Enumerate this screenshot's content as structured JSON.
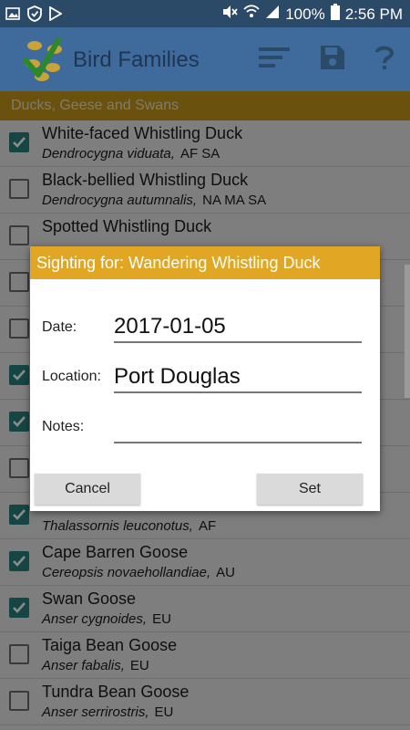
{
  "status_bar": {
    "battery": "100%",
    "time": "2:56 PM"
  },
  "app_bar": {
    "title": "Bird Families"
  },
  "section": {
    "title": "Ducks, Geese and Swans"
  },
  "birds": [
    {
      "name": "White-faced Whistling Duck",
      "scientific": "Dendrocygna viduata,",
      "regions": "AF  SA",
      "checked": true
    },
    {
      "name": "Black-bellied Whistling Duck",
      "scientific": "Dendrocygna autumnalis,",
      "regions": "NA  MA  SA",
      "checked": false
    },
    {
      "name": "Spotted Whistling Duck",
      "scientific": "",
      "regions": "",
      "checked": false
    },
    {
      "name": "",
      "scientific": "",
      "regions": "",
      "checked": false
    },
    {
      "name": "",
      "scientific": "",
      "regions": "",
      "checked": false
    },
    {
      "name": "",
      "scientific": "",
      "regions": "",
      "checked": true
    },
    {
      "name": "",
      "scientific": "",
      "regions": "",
      "checked": true
    },
    {
      "name": "",
      "scientific": "",
      "regions": "",
      "checked": false
    },
    {
      "name": "",
      "scientific": "Thalassornis leuconotus,",
      "regions": "AF",
      "checked": true
    },
    {
      "name": "Cape Barren Goose",
      "scientific": "Cereopsis novaehollandiae,",
      "regions": "AU",
      "checked": true
    },
    {
      "name": "Swan Goose",
      "scientific": "Anser cygnoides,",
      "regions": "EU",
      "checked": true
    },
    {
      "name": "Taiga Bean Goose",
      "scientific": "Anser fabalis,",
      "regions": "EU",
      "checked": false
    },
    {
      "name": "Tundra Bean Goose",
      "scientific": "Anser serrirostris,",
      "regions": "EU",
      "checked": false
    }
  ],
  "dialog": {
    "title": "Sighting for: Wandering Whistling Duck",
    "date_label": "Date:",
    "date_value": "2017-01-05",
    "location_label": "Location:",
    "location_value": "Port Douglas",
    "notes_label": "Notes:",
    "notes_value": "",
    "cancel_label": "Cancel",
    "set_label": "Set"
  },
  "colors": {
    "status_bar": "#2b4a68",
    "app_bar": "#3e6b9b",
    "section_header": "#c1951b",
    "dialog_title": "#e1a624",
    "checkbox": "#27807a"
  },
  "icons": [
    "gallery-icon",
    "shield-icon",
    "play-store-icon",
    "mute-icon",
    "wifi-icon",
    "signal-icon",
    "battery-icon",
    "app-logo-icon",
    "sort-icon",
    "save-icon",
    "help-icon"
  ]
}
